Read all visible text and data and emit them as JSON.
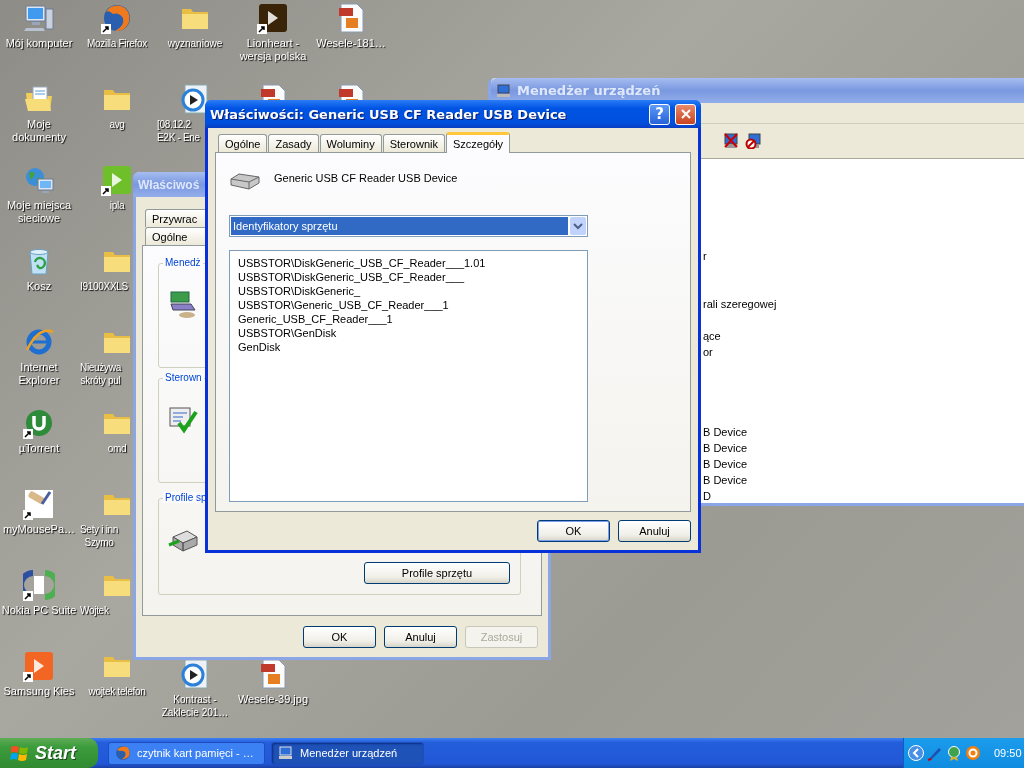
{
  "desktop": {
    "columns": [
      {
        "top": [
          {
            "label": "Mój komputer",
            "kind": "computer",
            "shortcut": false
          },
          {
            "label": "Moje\ndokumenty",
            "kind": "documents",
            "shortcut": false
          },
          {
            "label": "Moje miejsca\nsieciowe",
            "kind": "network",
            "shortcut": false
          },
          {
            "label": "Kosz",
            "kind": "bin",
            "shortcut": false
          },
          {
            "label": "Internet\nExplorer",
            "kind": "globe",
            "shortcut": false
          },
          {
            "label": "µTorrent",
            "kind": "torrent",
            "shortcut": true
          },
          {
            "label": "myMousePa…",
            "kind": "roller",
            "shortcut": true
          },
          {
            "label": "Nokia PC Suite",
            "kind": "suite",
            "shortcut": true
          },
          {
            "label": "Samsung Kies",
            "kind": "app",
            "color": "#f26522",
            "shortcut": true
          }
        ]
      },
      {
        "top": [
          {
            "label": "Mozilla Firefox",
            "kind": "firefox",
            "shortcut": true
          },
          {
            "label": "avg",
            "kind": "folder",
            "shortcut": false
          },
          {
            "label": "ipla",
            "kind": "app",
            "color": "#6fbf2a",
            "shortcut": true
          },
          {
            "label": "I9100XXLS",
            "kind": "folder",
            "shortcut": false
          },
          {
            "label": "Nieużywa\nskróty pul",
            "kind": "folder",
            "shortcut": false
          },
          {
            "label": "omd",
            "kind": "folder",
            "shortcut": false
          },
          {
            "label": "Sety i inn\nSzymo",
            "kind": "folder",
            "shortcut": false
          },
          {
            "label": "Wojtek",
            "kind": "folder",
            "shortcut": false
          },
          {
            "label": "wojtek telefon",
            "kind": "folder",
            "shortcut": false
          }
        ]
      },
      {
        "top": [
          {
            "label": "wyznaniowe",
            "kind": "folder",
            "shortcut": false
          },
          {
            "label": "[08.12.2\nE2K - Ene",
            "kind": "media",
            "shortcut": false
          }
        ],
        "bottom": [
          {
            "label": "Kontrast -\nZaklecie 201…",
            "kind": "media",
            "shortcut": false
          }
        ]
      },
      {
        "top": [
          {
            "label": "Lionheart -\nwersja polska",
            "kind": "app",
            "color": "#3a2408",
            "shortcut": true
          },
          {
            "kind": "document",
            "shortcut": false
          }
        ],
        "bottom": [
          {
            "label": "Wesele-39.jpg",
            "kind": "document",
            "shortcut": false
          }
        ]
      },
      {
        "top": [
          {
            "label": "Wesele-181…",
            "kind": "document",
            "shortcut": false
          },
          {
            "kind": "document",
            "shortcut": false
          }
        ]
      }
    ]
  },
  "device_manager": {
    "title": "Menedżer urządzeń",
    "tree_blocks": [
      [
        "r"
      ],
      [
        "rali szeregowej"
      ],
      [
        "ące",
        "or"
      ],
      [
        "B Device",
        "B Device",
        "B Device",
        "B Device",
        "D"
      ]
    ]
  },
  "system_dialog": {
    "title": "Właściwoś",
    "tabs_row_1": [
      {
        "label": "Przywrac",
        "selected": false
      }
    ],
    "tabs_row_2": [
      {
        "label": "Ogólne",
        "selected": false
      }
    ],
    "groups": [
      {
        "title": "Menedż",
        "kind": "devices"
      },
      {
        "title": "Sterown",
        "kind": "drivers"
      },
      {
        "title": "Profile sp",
        "kind": "profiles",
        "button": "Profile sprzętu"
      }
    ],
    "buttons": [
      {
        "label": "OK",
        "disabled": false
      },
      {
        "label": "Anuluj",
        "disabled": false
      },
      {
        "label": "Zastosuj",
        "disabled": true
      }
    ]
  },
  "properties_dialog": {
    "title": "Właściwości: Generic USB CF Reader USB Device",
    "help_button": "?",
    "tabs": [
      {
        "label": "Ogólne",
        "selected": false
      },
      {
        "label": "Zasady",
        "selected": false
      },
      {
        "label": "Woluminy",
        "selected": false
      },
      {
        "label": "Sterownik",
        "selected": false
      },
      {
        "label": "Szczegóły",
        "selected": true
      }
    ],
    "device_name": "Generic USB CF Reader USB Device",
    "property_select": {
      "value": "Identyfikatory sprzętu"
    },
    "values": [
      "USBSTOR\\DiskGeneric_USB_CF_Reader___1.01",
      "USBSTOR\\DiskGeneric_USB_CF_Reader___",
      "USBSTOR\\DiskGeneric_",
      "USBSTOR\\Generic_USB_CF_Reader___1",
      "Generic_USB_CF_Reader___1",
      "USBSTOR\\GenDisk",
      "GenDisk"
    ],
    "buttons": [
      "OK",
      "Anuluj"
    ]
  },
  "taskbar": {
    "start": "Start",
    "tasks": [
      {
        "label": "czytnik kart pamięci - …",
        "kind": "browser",
        "selected": false
      },
      {
        "label": "Menedżer urządzeń",
        "kind": "computer",
        "selected": true
      }
    ],
    "clock": "09:50"
  }
}
